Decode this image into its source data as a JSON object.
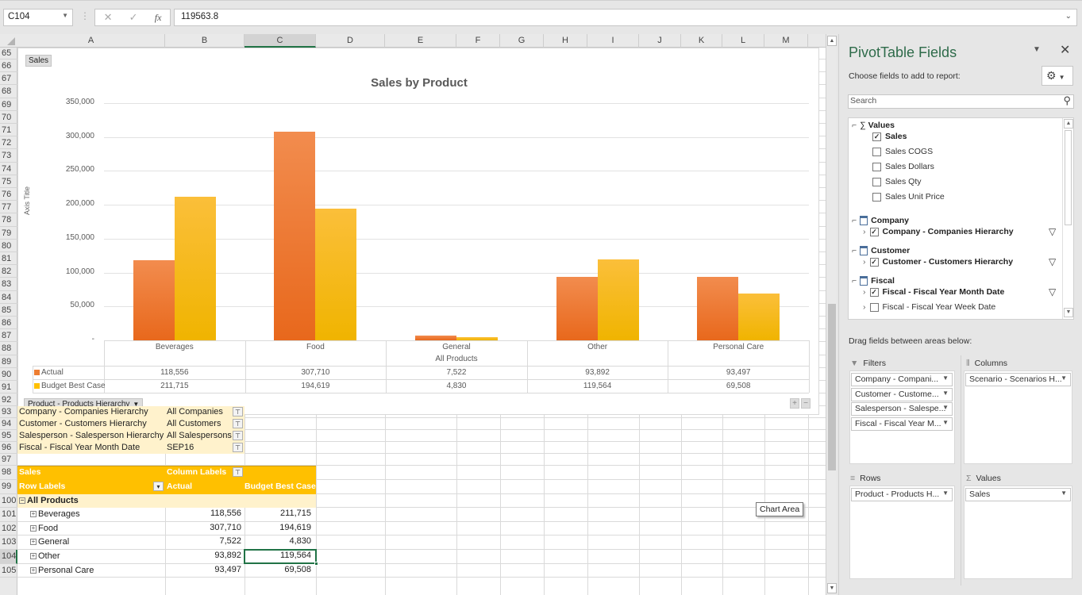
{
  "formula_bar": {
    "name_box": "C104",
    "cancel_icon": "✕",
    "enter_icon": "✓",
    "fx_label": "fx",
    "formula": "119563.8"
  },
  "columns": [
    "A",
    "B",
    "C",
    "D",
    "E",
    "F",
    "G",
    "H",
    "I",
    "J",
    "K",
    "L",
    "M"
  ],
  "selected_column": "C",
  "rows": [
    "65",
    "66",
    "67",
    "68",
    "69",
    "70",
    "71",
    "72",
    "73",
    "74",
    "75",
    "76",
    "77",
    "78",
    "79",
    "80",
    "81",
    "82",
    "83",
    "84",
    "85",
    "86",
    "87",
    "88",
    "89",
    "90",
    "91",
    "92",
    "93",
    "94",
    "95",
    "96",
    "97",
    "98",
    "99",
    "100",
    "101",
    "102",
    "103",
    "104",
    "105"
  ],
  "selected_row": "104",
  "chart": {
    "field_button": "Sales",
    "axis_title": "Axis Title",
    "product_field_button": "Product - Products Hierarchy",
    "plus_label": "+",
    "minus_label": "−",
    "tooltip": "Chart Area"
  },
  "chart_data": {
    "type": "bar",
    "title": "Sales by Product",
    "xlabel": "All Products",
    "ylabel": "Axis Title",
    "categories": [
      "Beverages",
      "Food",
      "General",
      "Other",
      "Personal Care"
    ],
    "series": [
      {
        "name": "Actual",
        "color": "#ed7d31",
        "values": [
          118556,
          307710,
          7522,
          93892,
          93497
        ],
        "labels": [
          "118,556",
          "307,710",
          "7,522",
          "93,892",
          "93,497"
        ]
      },
      {
        "name": "Budget Best Case",
        "color": "#ffc000",
        "values": [
          211715,
          194619,
          4830,
          119564,
          69508
        ],
        "labels": [
          "211,715",
          "194,619",
          "4,830",
          "119,564",
          "69,508"
        ]
      }
    ],
    "ylim": [
      0,
      350000
    ],
    "yticks": [
      "-",
      "50,000",
      "100,000",
      "150,000",
      "200,000",
      "250,000",
      "300,000",
      "350,000"
    ],
    "grid": true,
    "legend": "data-table"
  },
  "pivot_filters": [
    {
      "field": "Company - Companies Hierarchy",
      "value": "All Companies"
    },
    {
      "field": "Customer - Customers Hierarchy",
      "value": "All Customers"
    },
    {
      "field": "Salesperson - Salesperson Hierarchy",
      "value": "All Salespersons"
    },
    {
      "field": "Fiscal - Fiscal Year Month Date",
      "value": "SEP16"
    }
  ],
  "pivot_table": {
    "values_label": "Sales",
    "column_labels": "Column Labels",
    "row_labels": "Row Labels",
    "col_headers": [
      "Actual",
      "Budget Best Case"
    ],
    "total_row": "All Products",
    "rows": [
      {
        "label": "Beverages",
        "actual": "118,556",
        "budget": "211,715"
      },
      {
        "label": "Food",
        "actual": "307,710",
        "budget": "194,619"
      },
      {
        "label": "General",
        "actual": "7,522",
        "budget": "4,830"
      },
      {
        "label": "Other",
        "actual": "93,892",
        "budget": "119,564"
      },
      {
        "label": "Personal Care",
        "actual": "93,497",
        "budget": "69,508"
      }
    ]
  },
  "pane": {
    "title": "PivotTable Fields",
    "choose_label": "Choose fields to add to report:",
    "search_placeholder": "Search",
    "values_group": "Values",
    "value_fields": [
      {
        "label": "Sales",
        "checked": true
      },
      {
        "label": "Sales COGS",
        "checked": false
      },
      {
        "label": "Sales Dollars",
        "checked": false
      },
      {
        "label": "Sales Qty",
        "checked": false
      },
      {
        "label": "Sales Unit Price",
        "checked": false
      }
    ],
    "tables": [
      {
        "name": "Company",
        "fields": [
          {
            "label": "Company - Companies Hierarchy",
            "checked": true
          }
        ]
      },
      {
        "name": "Customer",
        "fields": [
          {
            "label": "Customer - Customers Hierarchy",
            "checked": true
          }
        ]
      },
      {
        "name": "Fiscal",
        "fields": [
          {
            "label": "Fiscal - Fiscal Year Month Date",
            "checked": true
          },
          {
            "label": "Fiscal - Fiscal Year Week Date",
            "checked": false
          }
        ]
      }
    ],
    "drag_label": "Drag fields between areas below:",
    "areas": {
      "filters_label": "Filters",
      "columns_label": "Columns",
      "rows_label": "Rows",
      "values_label": "Values",
      "filters": [
        "Company - Compani...",
        "Customer - Custome...",
        "Salesperson - Salespe...",
        "Fiscal - Fiscal Year M..."
      ],
      "columns": [
        "Scenario - Scenarios H..."
      ],
      "rows": [
        "Product - Products H..."
      ],
      "values": [
        "Sales"
      ]
    }
  }
}
